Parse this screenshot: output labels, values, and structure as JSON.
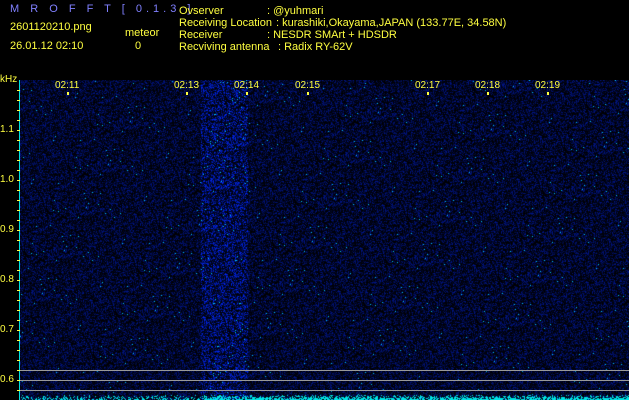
{
  "app": {
    "title": "M R O F F T [ 0.1.3 ]",
    "filename": "2601120210.png",
    "datetime": "26.01.12 02:10",
    "meteor_label": "meteor",
    "meteor_count": "0"
  },
  "info": [
    {
      "label": "Ovserver",
      "value": ": @yuhmari"
    },
    {
      "label": "Receiving Location",
      "value": ": kurashiki,Okayama,JAPAN (133.77E, 34.58N)"
    },
    {
      "label": "Receiver",
      "value": ": NESDR SMArt + HDSDR"
    },
    {
      "label": "Recviving antenna",
      "value": ": Radix RY-62V"
    }
  ],
  "axis": {
    "unit": "kHz",
    "y_ticks": [
      "1.1",
      "1.0",
      "0.9",
      "0.8",
      "0.7",
      "0.6"
    ],
    "x_ticks": [
      "02:11",
      "02:13",
      "02:14",
      "02:15",
      "02:17",
      "02:18",
      "02:19"
    ]
  },
  "colors": {
    "background": "#000000",
    "signal": "#2030ff",
    "axis": "#00e0e0",
    "text": "#ffff40",
    "title": "#8080ff"
  }
}
